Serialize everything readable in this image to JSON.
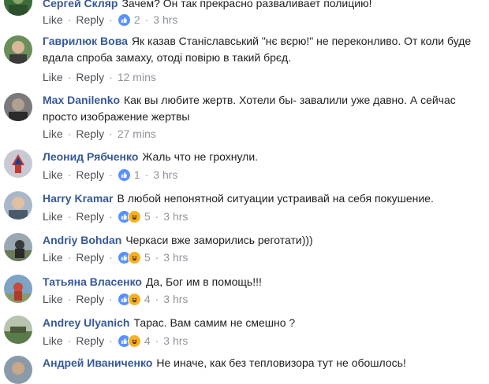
{
  "labels": {
    "like": "Like",
    "reply": "Reply"
  },
  "comments": [
    {
      "author": "Сергей Скляр",
      "text": "Зачем? Он так прекрасно разваливает полицию!",
      "reactions": [
        "like"
      ],
      "count": "2",
      "time": "3 hrs"
    },
    {
      "author": "Гаврилюк Вова",
      "text": "Як казав Станіславський \"нє вєрю!\" не переконливо. От коли буде вдала спроба замаху, отоді повірю в такий брєд.",
      "reactions": [],
      "count": "",
      "time": "12 mins"
    },
    {
      "author": "Max Danilenko",
      "text": "Как вы любите жертв. Хотели бы- завалили уже давно. А сейчас просто изображение жертвы",
      "reactions": [],
      "count": "",
      "time": "27 mins"
    },
    {
      "author": "Леонид Рябченко",
      "text": "Жаль что не грохнули.",
      "reactions": [
        "like"
      ],
      "count": "1",
      "time": "3 hrs"
    },
    {
      "author": "Harry Kramar",
      "text": "В любой непонятной ситуации устраивай на себя покушение.",
      "reactions": [
        "like",
        "haha"
      ],
      "count": "5",
      "time": "3 hrs"
    },
    {
      "author": "Andriy Bohdan",
      "text": "Черкаси вже заморились реготати)))",
      "reactions": [
        "like",
        "haha"
      ],
      "count": "5",
      "time": "3 hrs"
    },
    {
      "author": "Татьяна Власенко",
      "text": "Да, Бог им в помощь!!!",
      "reactions": [
        "like",
        "haha"
      ],
      "count": "4",
      "time": "3 hrs"
    },
    {
      "author": "Andrey Ulyanich",
      "text": "Тарас. Вам самим не смешно ?",
      "reactions": [
        "like",
        "haha"
      ],
      "count": "4",
      "time": "3 hrs"
    },
    {
      "author": "Андрей Иваниченко",
      "text": "Не иначе, как без тепловизора тут не обошлось!",
      "reactions": [],
      "count": "",
      "time": ""
    }
  ],
  "colors": {
    "link": "#365899",
    "meta": "#90949c",
    "like": "#5890ff",
    "haha": "#f7b125"
  }
}
